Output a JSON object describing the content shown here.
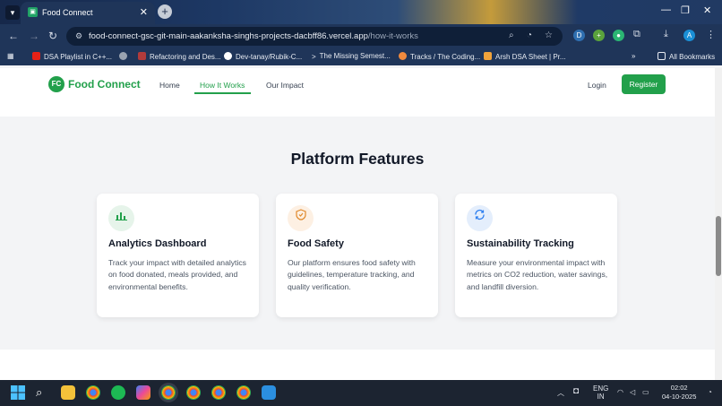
{
  "browser": {
    "tab_title": "Food Connect",
    "tab_close": "✕",
    "new_tab": "+",
    "url_host": "food-connect-gsc-git-main-aakanksha-singhs-projects-dacbff86.vercel.app",
    "url_path": "/how-it-works",
    "bookmarks": [
      "DSA Playlist in C++...",
      "Refactoring and Des...",
      "Dev-tanay/Rubik-C...",
      "The Missing Semest...",
      "Tracks / The Coding...",
      "Arsh DSA Sheet | Pr..."
    ],
    "all_bookmarks": "All Bookmarks",
    "profile_initial": "A"
  },
  "site": {
    "logo_badge": "FC",
    "logo_text": "Food Connect",
    "nav": [
      "Home",
      "How It Works",
      "Our Impact"
    ],
    "login": "Login",
    "register": "Register"
  },
  "features": {
    "title": "Platform Features",
    "cards": [
      {
        "icon": "chart-icon",
        "title": "Analytics Dashboard",
        "description": "Track your impact with detailed analytics on food donated, meals provided, and environmental benefits."
      },
      {
        "icon": "shield-icon",
        "title": "Food Safety",
        "description": "Our platform ensures food safety with guidelines, temperature tracking, and quality verification."
      },
      {
        "icon": "refresh-icon",
        "title": "Sustainability Tracking",
        "description": "Measure your environmental impact with metrics on CO2 reduction, water savings, and landfill diversion."
      }
    ]
  },
  "taskbar": {
    "lang_top": "ENG",
    "lang_bottom": "IN",
    "time": "02:02",
    "date": "04-10-2025"
  },
  "colors": {
    "brand_green": "#22a04b"
  }
}
